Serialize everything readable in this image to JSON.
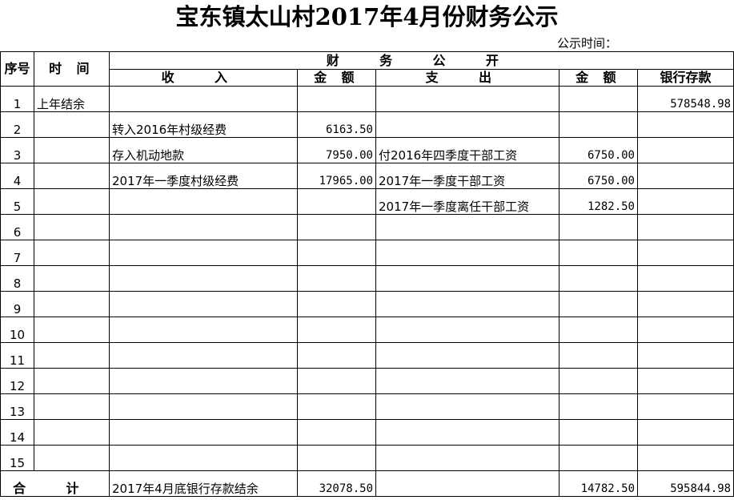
{
  "title": "宝东镇太山村2017年4月份财务公示",
  "announce_label": "公示时间：",
  "headers": {
    "index": "序号",
    "time": "时 间",
    "finance": "财 务 公 开",
    "income": "收 入",
    "amount": "金 额",
    "expense": "支 出",
    "bank_balance": "银行存款"
  },
  "rows": [
    {
      "no": "1",
      "time": "上年结余",
      "income": "",
      "income_amt": "",
      "expense": "",
      "expense_amt": "",
      "bank": "578548.98"
    },
    {
      "no": "2",
      "time": "",
      "income": "转入2016年村级经费",
      "income_amt": "6163.50",
      "expense": "",
      "expense_amt": "",
      "bank": ""
    },
    {
      "no": "3",
      "time": "",
      "income": "存入机动地款",
      "income_amt": "7950.00",
      "expense": "付2016年四季度干部工资",
      "expense_amt": "6750.00",
      "bank": ""
    },
    {
      "no": "4",
      "time": "",
      "income": "2017年一季度村级经费",
      "income_amt": "17965.00",
      "expense": "2017年一季度干部工资",
      "expense_amt": "6750.00",
      "bank": ""
    },
    {
      "no": "5",
      "time": "",
      "income": "",
      "income_amt": "",
      "expense": "2017年一季度离任干部工资",
      "expense_amt": "1282.50",
      "bank": ""
    },
    {
      "no": "6",
      "time": "",
      "income": "",
      "income_amt": "",
      "expense": "",
      "expense_amt": "",
      "bank": ""
    },
    {
      "no": "7",
      "time": "",
      "income": "",
      "income_amt": "",
      "expense": "",
      "expense_amt": "",
      "bank": ""
    },
    {
      "no": "8",
      "time": "",
      "income": "",
      "income_amt": "",
      "expense": "",
      "expense_amt": "",
      "bank": ""
    },
    {
      "no": "9",
      "time": "",
      "income": "",
      "income_amt": "",
      "expense": "",
      "expense_amt": "",
      "bank": ""
    },
    {
      "no": "10",
      "time": "",
      "income": "",
      "income_amt": "",
      "expense": "",
      "expense_amt": "",
      "bank": ""
    },
    {
      "no": "11",
      "time": "",
      "income": "",
      "income_amt": "",
      "expense": "",
      "expense_amt": "",
      "bank": ""
    },
    {
      "no": "12",
      "time": "",
      "income": "",
      "income_amt": "",
      "expense": "",
      "expense_amt": "",
      "bank": ""
    },
    {
      "no": "13",
      "time": "",
      "income": "",
      "income_amt": "",
      "expense": "",
      "expense_amt": "",
      "bank": ""
    },
    {
      "no": "14",
      "time": "",
      "income": "",
      "income_amt": "",
      "expense": "",
      "expense_amt": "",
      "bank": ""
    },
    {
      "no": "15",
      "time": "",
      "income": "",
      "income_amt": "",
      "expense": "",
      "expense_amt": "",
      "bank": ""
    }
  ],
  "total": {
    "label": "合 计",
    "income": "2017年4月底银行存款结余",
    "income_amt": "32078.50",
    "expense": "",
    "expense_amt": "14782.50",
    "bank": "595844.98"
  }
}
